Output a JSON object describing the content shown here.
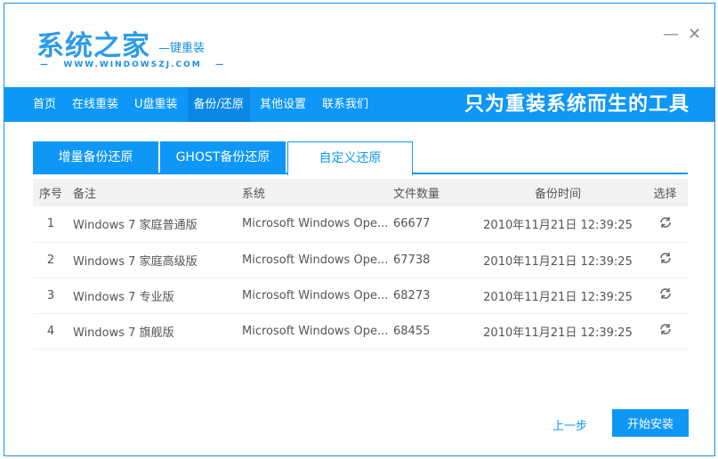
{
  "logo": {
    "title": "系统之家",
    "subtitle": "—键重装",
    "url": "WWW.WINDOWSZJ.COM"
  },
  "window": {
    "minimize": "—",
    "close": "✕"
  },
  "nav": {
    "items": [
      "首页",
      "在线重装",
      "U盘重装",
      "备份/还原",
      "其他设置",
      "联系我们"
    ],
    "active": 3,
    "slogan": "只为重装系统而生的工具"
  },
  "tabs": [
    "增量备份还原",
    "GHOST备份还原",
    "自定义还原"
  ],
  "table": {
    "headers": [
      "序号",
      "备注",
      "系统",
      "文件数量",
      "备份时间",
      "选择"
    ],
    "rows": [
      [
        "1",
        "Windows 7 家庭普通版",
        "Microsoft Windows Ope...",
        "66677",
        "2010年11月21日 12:39:25"
      ],
      [
        "2",
        "Windows 7 家庭高级版",
        "Microsoft Windows Ope...",
        "67738",
        "2010年11月21日 12:39:25"
      ],
      [
        "3",
        "Windows 7 专业版",
        "Microsoft Windows Ope...",
        "68273",
        "2010年11月21日 12:39:25"
      ],
      [
        "4",
        "Windows 7 旗舰版",
        "Microsoft Windows Ope...",
        "68455",
        "2010年11月21日 12:39:25"
      ]
    ]
  },
  "buttons": {
    "prev": "上一步",
    "start": "开始安装"
  },
  "colors": {
    "accent": "#0e97f7"
  }
}
